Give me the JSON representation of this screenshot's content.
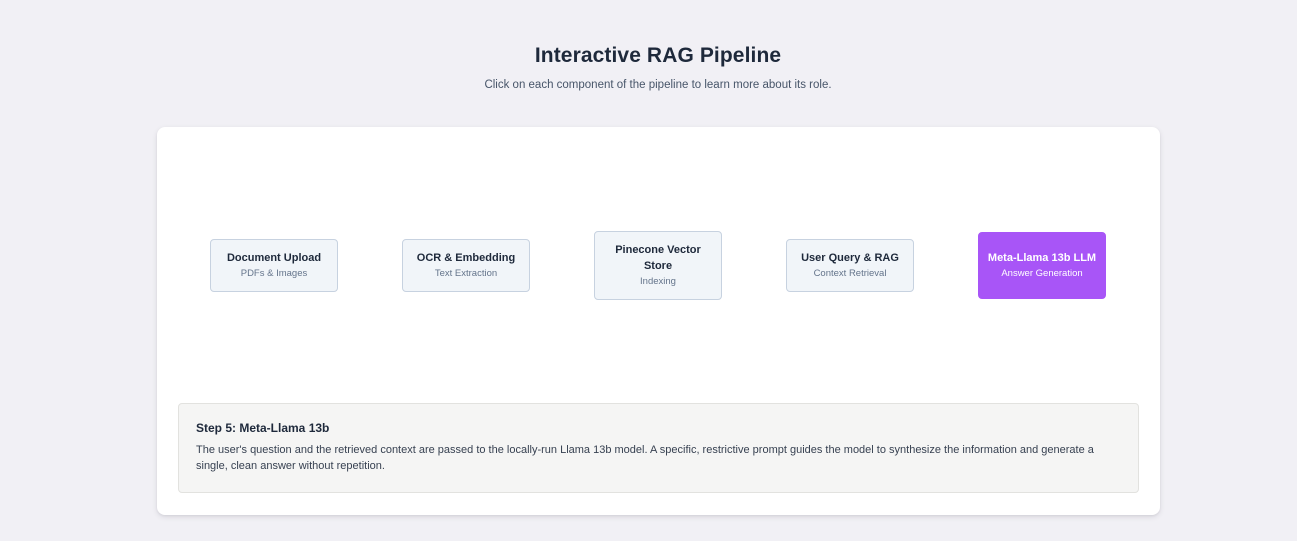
{
  "header": {
    "title": "Interactive RAG Pipeline",
    "subtitle": "Click on each component of the pipeline to learn more about its role."
  },
  "pipeline": {
    "nodes": [
      {
        "title": "Document Upload",
        "subtitle": "PDFs & Images",
        "active": false
      },
      {
        "title": "OCR & Embedding",
        "subtitle": "Text Extraction",
        "active": false
      },
      {
        "title": "Pinecone Vector Store",
        "subtitle": "Indexing",
        "active": false
      },
      {
        "title": "User Query & RAG",
        "subtitle": "Context Retrieval",
        "active": false
      },
      {
        "title": "Meta-Llama 13b LLM",
        "subtitle": "Answer Generation",
        "active": true
      }
    ],
    "active_color": "#a855f7"
  },
  "details": {
    "title": "Step 5: Meta-Llama 13b",
    "text": "The user's question and the retrieved context are passed to the locally-run Llama 13b model. A specific, restrictive prompt guides the model to synthesize the information and generate a single, clean answer without repetition."
  }
}
